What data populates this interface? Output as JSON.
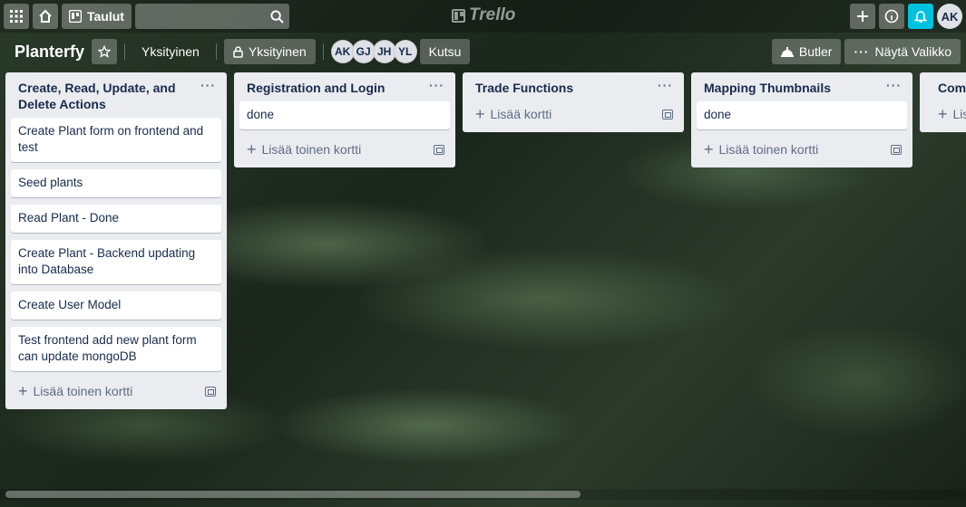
{
  "header": {
    "boards_label": "Taulut",
    "logo_text": "Trello",
    "user_initials": "AK"
  },
  "board": {
    "title": "Planterfy",
    "workspace_label": "Yksityinen",
    "visibility_label": "Yksityinen",
    "members": [
      "AK",
      "GJ",
      "JH",
      "YL"
    ],
    "invite_label": "Kutsu",
    "butler_label": "Butler",
    "menu_label": "Näytä Valikko"
  },
  "lists": [
    {
      "title": "Create, Read, Update, and Delete Actions",
      "cards": [
        "Create Plant form on frontend and test",
        "Seed plants",
        "Read Plant - Done",
        "Create Plant - Backend updating into Database",
        "Create User Model",
        "Test frontend add new plant form can update mongoDB"
      ],
      "add_label": "Lisää toinen kortti"
    },
    {
      "title": "Registration and Login",
      "cards": [
        "done"
      ],
      "add_label": "Lisää toinen kortti"
    },
    {
      "title": "Trade Functions",
      "cards": [],
      "add_label": "Lisää kortti"
    },
    {
      "title": "Mapping Thumbnails",
      "cards": [
        "done"
      ],
      "add_label": "Lisää toinen kortti"
    },
    {
      "title": "Comm",
      "cards": [],
      "add_label": "Lis"
    }
  ],
  "colors": {
    "notification": "#00c2e0",
    "list_bg": "#ebecf0"
  }
}
